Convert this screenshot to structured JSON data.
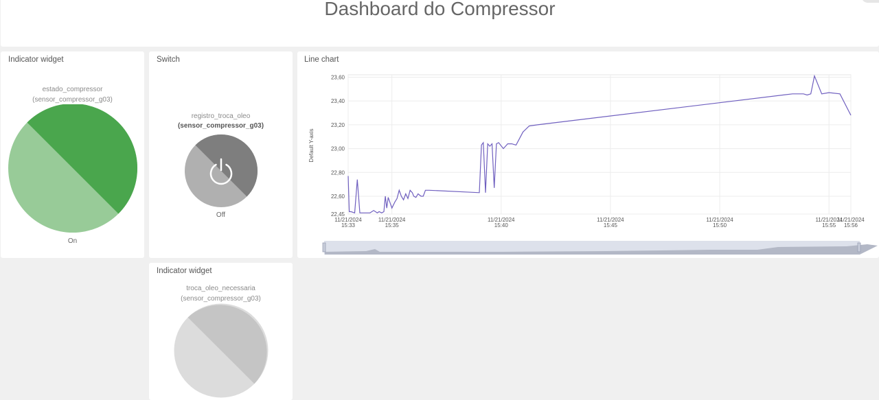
{
  "header": {
    "title": "Dashboard do Compressor"
  },
  "widgets": {
    "indicator1": {
      "title": "Indicator widget",
      "variable": "estado_compressor",
      "device": "(sensor_compressor_g03)",
      "state": "On",
      "color": "#4aa64d",
      "color_light": "#98cb98"
    },
    "switch": {
      "title": "Switch",
      "variable": "registro_troca_oleo",
      "device": "(sensor_compressor_g03)",
      "state": "Off",
      "icon": "power-icon",
      "color": "#7e7e7e",
      "color_light": "#b0b0b0"
    },
    "indicator2": {
      "title": "Indicator widget",
      "variable": "troca_oleo_necessaria",
      "device": "(sensor_compressor_g03)",
      "color": "#c5c5c5",
      "color_light": "#dcdcdc"
    },
    "line_chart": {
      "title": "Line chart",
      "line_color": "#6f5fbf"
    }
  },
  "chart_data": {
    "type": "line",
    "title": "",
    "xlabel": "",
    "ylabel": "Default Y-axis",
    "y_ticks": [
      "22,45",
      "22,60",
      "22,80",
      "23,00",
      "23,20",
      "23,40",
      "23,60"
    ],
    "ylim": [
      22.45,
      23.62
    ],
    "x_ticks": [
      {
        "date": "11/21/2024",
        "time": "15:33"
      },
      {
        "date": "11/21/2024",
        "time": "15:35"
      },
      {
        "date": "11/21/2024",
        "time": "15:40"
      },
      {
        "date": "11/21/2024",
        "time": "15:45"
      },
      {
        "date": "11/21/2024",
        "time": "15:50"
      },
      {
        "date": "11/21/2024",
        "time": "15:55"
      },
      {
        "date": "11/21/2024",
        "time": "15:56"
      }
    ],
    "xlim_minutes": [
      "15:33",
      "15:56"
    ],
    "grid": true,
    "series": [
      {
        "x": [
          "15:33:00",
          "15:33:03",
          "15:33:08",
          "15:33:18",
          "15:33:25",
          "15:33:32",
          "15:33:40",
          "15:33:50",
          "15:34:00",
          "15:34:10",
          "15:34:20",
          "15:34:25",
          "15:34:32",
          "15:34:38",
          "15:34:42",
          "15:34:46",
          "15:34:50",
          "15:35:00",
          "15:35:08",
          "15:35:14",
          "15:35:20",
          "15:35:26",
          "15:35:32",
          "15:35:38",
          "15:35:44",
          "15:35:50",
          "15:35:56",
          "15:36:00",
          "15:36:06",
          "15:36:12",
          "15:36:20",
          "15:36:26",
          "15:36:32",
          "15:36:42",
          "15:39:00",
          "15:39:06",
          "15:39:11",
          "15:39:17",
          "15:39:23",
          "15:39:29",
          "15:39:35",
          "15:39:41",
          "15:39:47",
          "15:39:53",
          "15:40:06",
          "15:40:18",
          "15:40:29",
          "15:40:41",
          "15:41:00",
          "15:41:17",
          "15:41:40",
          "15:53:20",
          "15:53:50",
          "15:54:00",
          "15:54:10",
          "15:54:20",
          "15:54:40",
          "15:55:00",
          "15:55:30",
          "15:56:00",
          "15:57:00"
        ],
        "y": [
          22.77,
          22.47,
          22.47,
          22.46,
          22.74,
          22.46,
          22.46,
          22.46,
          22.46,
          22.48,
          22.46,
          22.47,
          22.46,
          22.47,
          22.6,
          22.5,
          22.59,
          22.5,
          22.55,
          22.58,
          22.65,
          22.6,
          22.57,
          22.62,
          22.58,
          22.65,
          22.63,
          22.6,
          22.59,
          22.62,
          22.6,
          22.6,
          22.65,
          22.65,
          22.63,
          23.03,
          23.05,
          22.63,
          23.04,
          23.02,
          23.04,
          22.67,
          23.04,
          23.05,
          23.0,
          23.04,
          23.04,
          23.03,
          23.14,
          23.19,
          23.2,
          23.46,
          23.46,
          23.45,
          23.46,
          23.61,
          23.46,
          23.47,
          23.46,
          23.28,
          23.28
        ]
      }
    ]
  }
}
